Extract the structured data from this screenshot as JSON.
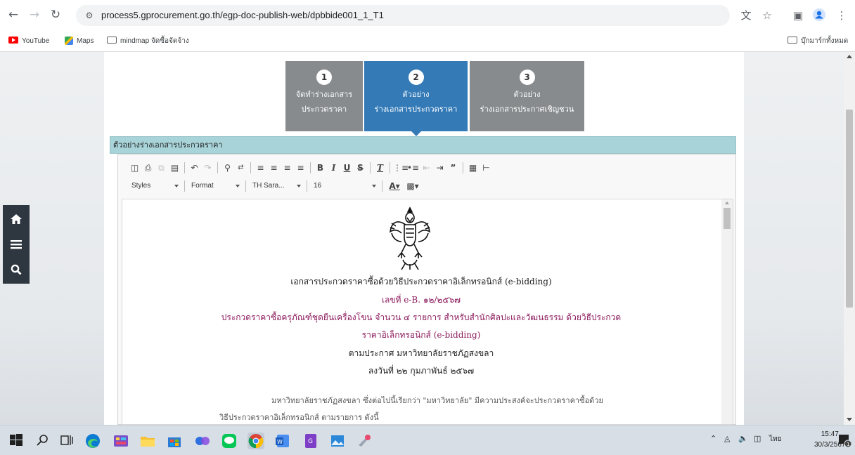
{
  "browser": {
    "url": "process5.gprocurement.go.th/egp-doc-publish-web/dpbbide001_1_T1"
  },
  "bookmarks": {
    "items": [
      "YouTube",
      "Maps",
      "mindmap จัดซื้อจัดจ้าง"
    ],
    "all_bookmarks": "บุ๊กมาร์กทั้งหมด"
  },
  "steps": [
    {
      "num": "1",
      "line1": "จัดทำร่างเอกสาร",
      "line2": "ประกวดราคา",
      "active": false
    },
    {
      "num": "2",
      "line1": "ตัวอย่าง",
      "line2": "ร่างเอกสารประกวดราคา",
      "active": true
    },
    {
      "num": "3",
      "line1": "ตัวอย่าง",
      "line2": "ร่างเอกสารประกาศเชิญชวน",
      "active": false
    }
  ],
  "panel": {
    "title": "ตัวอย่างร่างเอกสารประกวดราคา"
  },
  "editor": {
    "styles_label": "Styles",
    "format_label": "Format",
    "font_label": "TH Sara...",
    "size_label": "16"
  },
  "document": {
    "title": "เอกสารประกวดราคาซื้อด้วยวิธีประกวดราคาอิเล็กทรอนิกส์ (e-bidding)",
    "number": "เลขที่ e-B. ๑๒/๒๕๖๗",
    "subject_line1": "ประกวดราคาซื้อครุภัณฑ์ชุดยืนเครื่องโขน จำนวน ๔ รายการ สำหรับสำนักศิลปะและวัฒนธรรม ด้วยวิธีประกวด",
    "subject_line2": "ราคาอิเล็กทรอนิกส์ (e-bidding)",
    "announcement": "ตามประกาศ มหาวิทยาลัยราชภัฏสงขลา",
    "date": "ลงวันที่ ๒๒ กุมภาพันธ์ ๒๕๖๗",
    "para_line1": "มหาวิทยาลัยราชภัฏสงขลา ซึ่งต่อไปนี้เรียกว่า \"มหาวิทยาลัย\" มีความประสงค์จะประกวดราคาซื้อด้วย",
    "para_line2": "วิธีประกวดราคาอิเล็กทรอนิกส์ ตามรายการ ดังนี้"
  },
  "taskbar": {
    "lang": "ไทย",
    "time": "15:47",
    "date": "30/3/2567",
    "notifications": "1"
  }
}
